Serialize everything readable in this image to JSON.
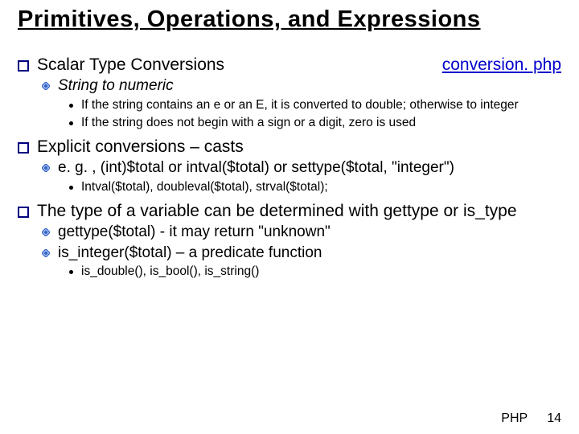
{
  "title": "Primitives, Operations, and Expressions",
  "section1": {
    "heading": "Scalar Type Conversions",
    "link": "conversion. php",
    "sub1": "String to numeric",
    "dot1": "If the string contains an e or an E, it is converted to double; otherwise to integer",
    "dot2": "If the string does not begin with a sign or a digit, zero is used"
  },
  "section2": {
    "heading": "Explicit conversions – casts",
    "sub1": "e. g. , (int)$total  or  intval($total)  or settype($total, \"integer\")",
    "dot1": "Intval($total), doubleval($total), strval($total);"
  },
  "section3": {
    "heading": "The type of a variable can be determined with gettype or is_type",
    "sub1": "gettype($total)  - it may return \"unknown\"",
    "sub2": "is_integer($total) – a predicate function",
    "dot1": "is_double(), is_bool(), is_string()"
  },
  "footer": {
    "label": "PHP",
    "page": "14"
  }
}
